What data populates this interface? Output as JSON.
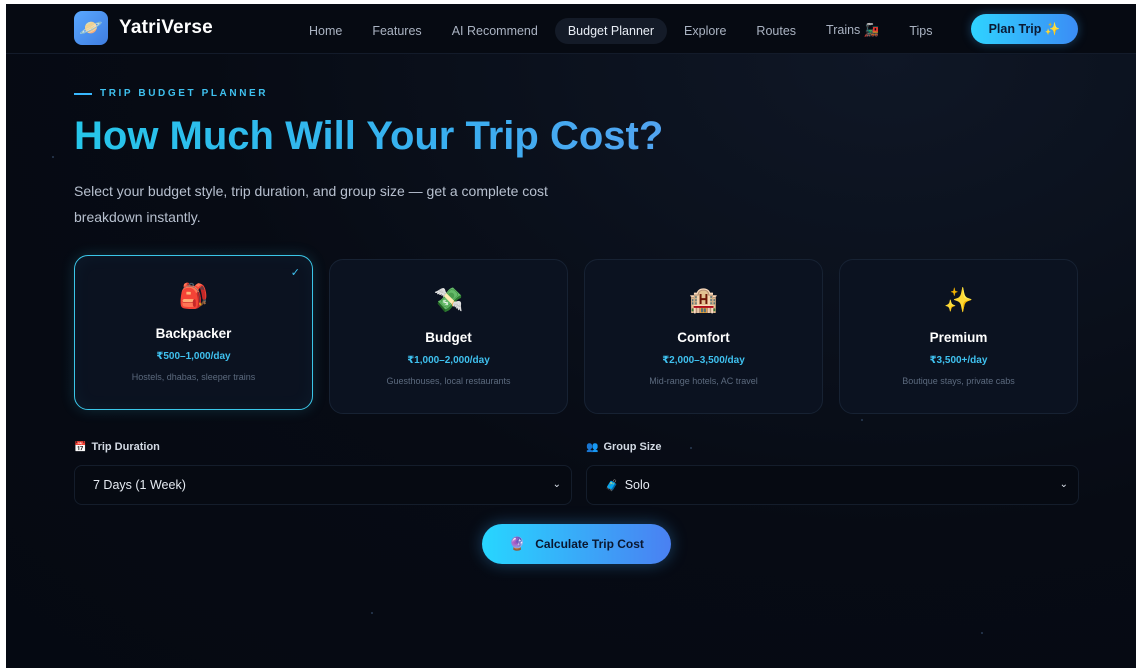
{
  "brand": {
    "name": "YatriVerse",
    "icon": "planet-icon",
    "glyph": "🪐"
  },
  "nav": {
    "items": [
      {
        "label": "Home",
        "active": false
      },
      {
        "label": "Features",
        "active": false
      },
      {
        "label": "AI Recommend",
        "active": false
      },
      {
        "label": "Budget Planner",
        "active": true
      },
      {
        "label": "Explore",
        "active": false
      },
      {
        "label": "Routes",
        "active": false
      },
      {
        "label": "Trains 🚂",
        "active": false
      },
      {
        "label": "Tips",
        "active": false
      }
    ],
    "cta_label": "Plan Trip ✨"
  },
  "hero": {
    "eyebrow": "TRIP BUDGET PLANNER",
    "title": "How Much Will Your Trip Cost?",
    "subtitle": "Select your budget style, trip duration, and group size — get a complete cost breakdown instantly."
  },
  "budget_styles": [
    {
      "icon": "backpack-icon",
      "glyph": "🎒",
      "name": "Backpacker",
      "price": "₹500–1,000/day",
      "desc": "Hostels, dhabas, sleeper trains",
      "selected": true,
      "check": "✓"
    },
    {
      "icon": "money-icon",
      "glyph": "💸",
      "name": "Budget",
      "price": "₹1,000–2,000/day",
      "desc": "Guesthouses, local restaurants",
      "selected": false
    },
    {
      "icon": "hotel-icon",
      "glyph": "🏨",
      "name": "Comfort",
      "price": "₹2,000–3,500/day",
      "desc": "Mid-range hotels, AC travel",
      "selected": false
    },
    {
      "icon": "sparkles-icon",
      "glyph": "✨",
      "name": "Premium",
      "price": "₹3,500+/day",
      "desc": "Boutique stays, private cabs",
      "selected": false
    }
  ],
  "form": {
    "duration": {
      "icon": "calendar-icon",
      "glyph": "📅",
      "label": "Trip Duration",
      "value": "7 Days (1 Week)"
    },
    "group": {
      "icon": "people-icon",
      "glyph": "👥",
      "label": "Group Size",
      "value": "Solo",
      "value_icon": "person-icon",
      "value_glyph": "🧳"
    },
    "chevron": "⌄"
  },
  "calculate": {
    "icon": "crystal-ball-icon",
    "glyph": "🔮",
    "label": "Calculate Trip Cost"
  },
  "colors": {
    "accent": "#3fc1ef",
    "accent_blue": "#3b8cf5",
    "bg": "#070b14",
    "card_bg": "#0b1220"
  }
}
